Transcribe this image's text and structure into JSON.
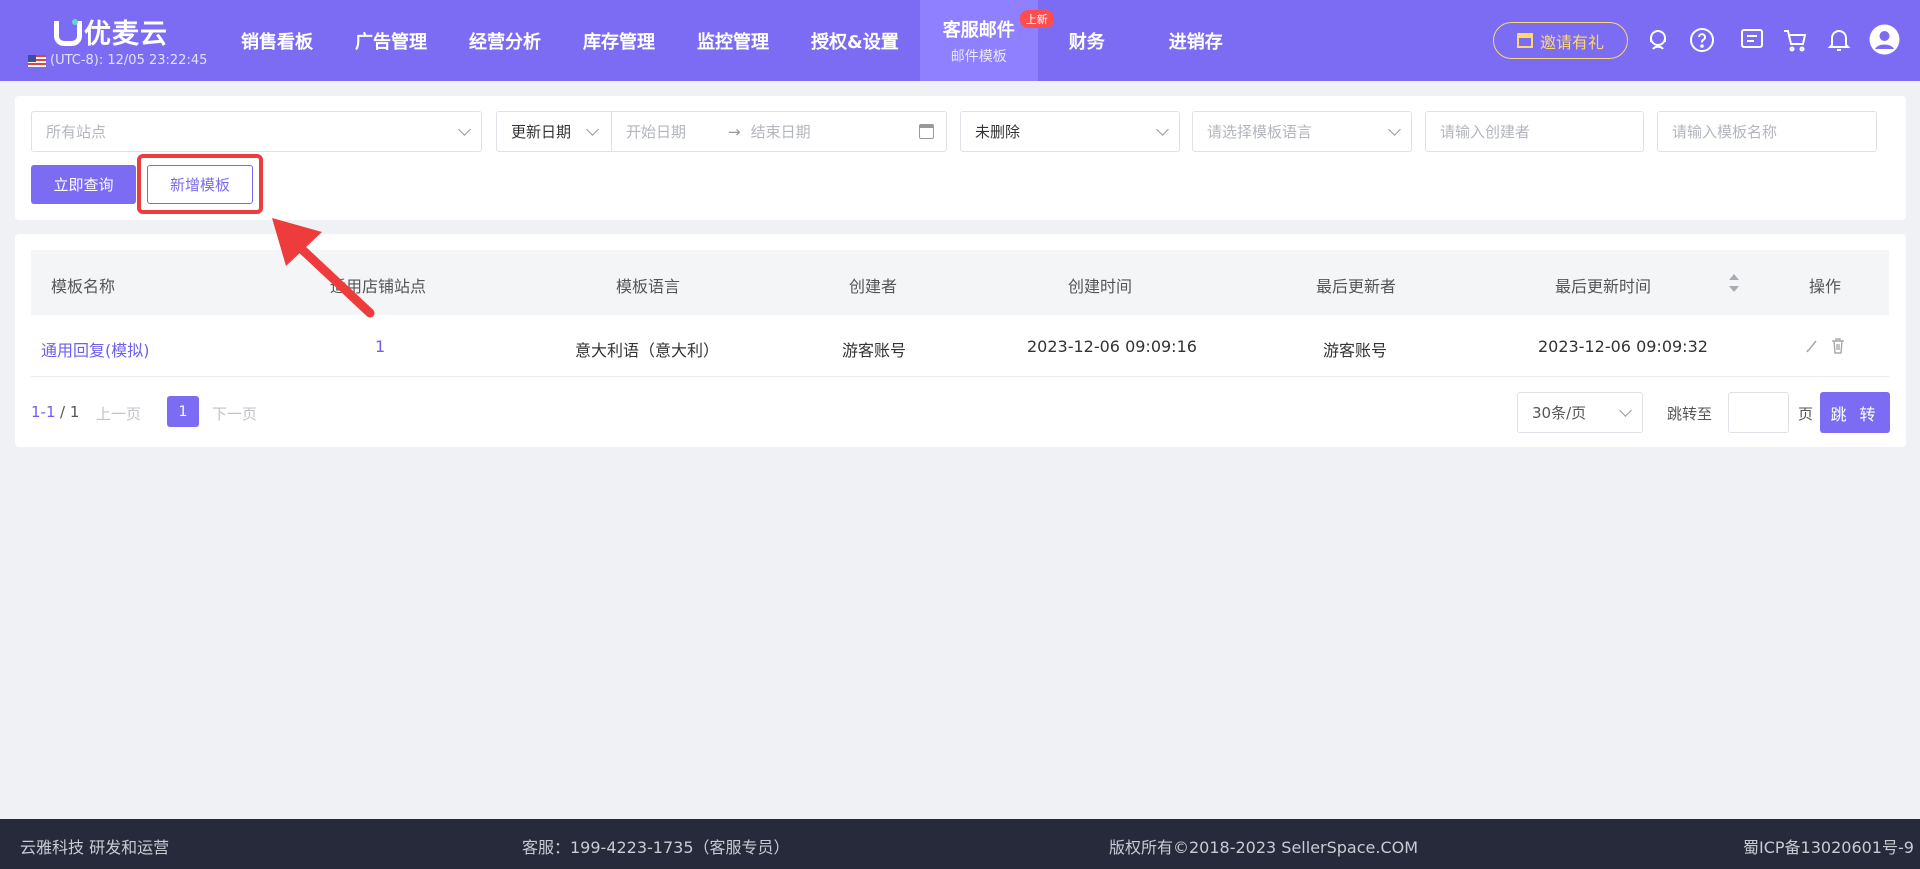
{
  "header": {
    "logo": "优麦云",
    "timezone": "(UTC-8): 12/05 23:22:45",
    "nav": [
      {
        "label": "销售看板"
      },
      {
        "label": "广告管理"
      },
      {
        "label": "经营分析"
      },
      {
        "label": "库存管理"
      },
      {
        "label": "监控管理"
      },
      {
        "label": "授权&设置"
      },
      {
        "label": "客服邮件",
        "sub": "邮件模板",
        "badge": "上新",
        "active": true
      },
      {
        "label": "财务"
      },
      {
        "label": "进销存"
      }
    ],
    "invite": "邀请有礼"
  },
  "filters": {
    "site_placeholder": "所有站点",
    "date_type": "更新日期",
    "start_placeholder": "开始日期",
    "end_placeholder": "结束日期",
    "status": "未删除",
    "language_placeholder": "请选择模板语言",
    "creator_placeholder": "请输入创建者",
    "name_placeholder": "请输入模板名称",
    "query_button": "立即查询",
    "add_button": "新增模板"
  },
  "table": {
    "columns": [
      "模板名称",
      "适用店铺站点",
      "模板语言",
      "创建者",
      "创建时间",
      "最后更新者",
      "最后更新时间",
      "操作"
    ],
    "rows": [
      [
        "通用回复(模拟)",
        "1",
        "意大利语（意大利）",
        "游客账号",
        "2023-12-06 09:09:16",
        "游客账号",
        "2023-12-06 09:09:32"
      ]
    ]
  },
  "pagination": {
    "range": "1-1",
    "total": "/ 1",
    "prev": "上一页",
    "current": "1",
    "next": "下一页",
    "page_size": "30条/页",
    "jump_label": "跳转至",
    "page_unit": "页",
    "jump_button": "跳 转"
  },
  "footer": {
    "company": "云雅科技 研发和运营",
    "service": "客服：199-4223-1735（客服专员）",
    "copyright": "版权所有©2018-2023 SellerSpace.COM",
    "icp": "蜀ICP备13020601号-9"
  },
  "colors": {
    "accent": "#7b6cf3",
    "highlight": "#ee3b3b",
    "footer": "#262a3b"
  }
}
